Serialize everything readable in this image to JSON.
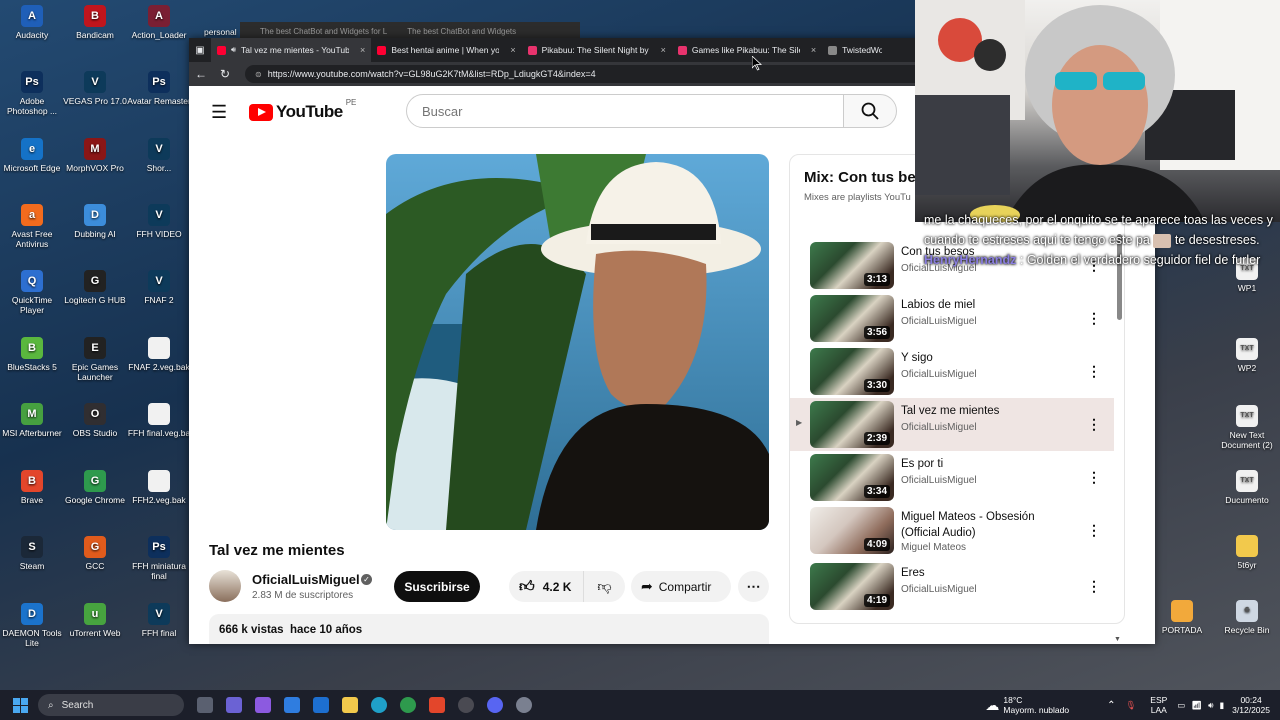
{
  "desktop": {
    "icons": [
      {
        "label": "Audacity",
        "color": "#1f5fb8",
        "g": "A"
      },
      {
        "label": "Bandicam",
        "color": "#c0151d",
        "g": "B"
      },
      {
        "label": "Action_Loader",
        "color": "#7a1f33",
        "g": "A"
      },
      {
        "label": "Adobe Photoshop ...",
        "color": "#0d2f5c",
        "g": "Ps"
      },
      {
        "label": "VEGAS Pro 17.0",
        "color": "#0d3a5a",
        "g": "V"
      },
      {
        "label": "Avatar Remaster",
        "color": "#0d2f5c",
        "g": "Ps"
      },
      {
        "label": "Microsoft Edge",
        "color": "#1572c7",
        "g": "e"
      },
      {
        "label": "MorphVOX Pro",
        "color": "#8a1616",
        "g": "M"
      },
      {
        "label": "Shor...",
        "color": "#0d3a5a",
        "g": "V"
      },
      {
        "label": "Avast Free Antivirus",
        "color": "#f26b1d",
        "g": "a"
      },
      {
        "label": "Dubbing AI",
        "color": "#3c8ddb",
        "g": "D"
      },
      {
        "label": "FFH VIDEO",
        "color": "#0d3a5a",
        "g": "V"
      },
      {
        "label": "QuickTime Player",
        "color": "#2d6fd0",
        "g": "Q"
      },
      {
        "label": "Logitech G HUB",
        "color": "#222222",
        "g": "G"
      },
      {
        "label": "FNAF 2",
        "color": "#0d3a5a",
        "g": "V"
      },
      {
        "label": "BlueStacks 5",
        "color": "#5ab73e",
        "g": "B"
      },
      {
        "label": "Epic Games Launcher",
        "color": "#222222",
        "g": "E"
      },
      {
        "label": "FNAF 2.veg.bak",
        "color": "#f1f1f1",
        "g": ""
      },
      {
        "label": "MSI Afterburner",
        "color": "#46a040",
        "g": "M"
      },
      {
        "label": "OBS Studio",
        "color": "#302e31",
        "g": "O"
      },
      {
        "label": "FFH final.veg.ba",
        "color": "#f1f1f1",
        "g": ""
      },
      {
        "label": "Brave",
        "color": "#e3462b",
        "g": "B"
      },
      {
        "label": "Google Chrome",
        "color": "#2e9a4d",
        "g": "G"
      },
      {
        "label": "FFH2.veg.bak",
        "color": "#f1f1f1",
        "g": ""
      },
      {
        "label": "Steam",
        "color": "#1b2838",
        "g": "S"
      },
      {
        "label": "GCC",
        "color": "#e05b1c",
        "g": "G"
      },
      {
        "label": "FFH miniatura final",
        "color": "#0d2f5c",
        "g": "Ps"
      },
      {
        "label": "DAEMON Tools Lite",
        "color": "#1b73cc",
        "g": "D"
      },
      {
        "label": "uTorrent Web",
        "color": "#47a43f",
        "g": "u"
      },
      {
        "label": "FFH final",
        "color": "#0d3a5a",
        "g": "V"
      }
    ],
    "right_icons": [
      {
        "label": "WP1",
        "color": "#f1f1f1",
        "g": "TXT"
      },
      {
        "label": "WP2",
        "color": "#f1f1f1",
        "g": "TXT"
      },
      {
        "label": "New Text Document (2)",
        "color": "#f1f1f1",
        "g": "TXT"
      },
      {
        "label": "Ducumento",
        "color": "#f1f1f1",
        "g": "TXT"
      },
      {
        "label": "5t6yr",
        "color": "#f2c94c",
        "g": ""
      },
      {
        "label": "PORTADA",
        "color": "#f2a93b",
        "g": ""
      },
      {
        "label": "Recycle Bin",
        "color": "#cfd8e3",
        "g": "♻"
      }
    ],
    "partial_label": "personal",
    "back_tab_1": "The best ChatBot and Widgets for L",
    "back_tab_2": "The best ChatBot and Widgets"
  },
  "browser": {
    "tabs": [
      {
        "label": "Tal vez me mientes - YouTub",
        "active": true
      },
      {
        "label": "Best hentai anime | When you m",
        "active": false
      },
      {
        "label": "Pikabuu: The Silent Night by Joyk",
        "active": false
      },
      {
        "label": "Games like Pikabuu: The Silent Ni",
        "active": false
      },
      {
        "label": "TwistedWo",
        "active": false
      }
    ],
    "url": "https://www.youtube.com/watch?v=GL98uG2K7tM&list=RDp_LdiugkGT4&index=4"
  },
  "youtube": {
    "country_code": "PE",
    "logo_text": "YouTube",
    "search_placeholder": "Buscar",
    "video_title": "Tal vez me mientes",
    "channel_name": "OficialLuisMiguel",
    "subscribers": "2.83 M de suscriptores",
    "subscribe_label": "Suscribirse",
    "likes": "4.2 K",
    "share_label": "Compartir",
    "views_meta": "666 k vistas  hace 10 años"
  },
  "playlist": {
    "title": "Mix: Con tus be",
    "subtitle": "Mixes are playlists YouTu",
    "items": [
      {
        "title": "Con tus besos",
        "channel": "OficialLuisMiguel",
        "duration": "3:13",
        "current": false,
        "alt": false
      },
      {
        "title": "Labios de miel",
        "channel": "OficialLuisMiguel",
        "duration": "3:56",
        "current": false,
        "alt": false
      },
      {
        "title": "Y sigo",
        "channel": "OficialLuisMiguel",
        "duration": "3:30",
        "current": false,
        "alt": false
      },
      {
        "title": "Tal vez me mientes",
        "channel": "OficialLuisMiguel",
        "duration": "2:39",
        "current": true,
        "alt": false
      },
      {
        "title": "Es por ti",
        "channel": "OficialLuisMiguel",
        "duration": "3:34",
        "current": false,
        "alt": false
      },
      {
        "title": "Miguel Mateos - Obsesión (Official Audio)",
        "channel": "Miguel Mateos",
        "duration": "4:09",
        "current": false,
        "alt": true
      },
      {
        "title": "Eres",
        "channel": "OficialLuisMiguel",
        "duration": "4:19",
        "current": false,
        "alt": false
      }
    ]
  },
  "chat": {
    "line1": "me la chaqueces, por el onquito se te aparece toas las veces y cuando te estreses aqui te tengo este pa",
    "line1b": "te desestreses.",
    "user": "HenryHernandz",
    "line2": ": Golden el verdadero seguidor fiel de furler"
  },
  "taskbar": {
    "search_label": "Search",
    "weather_temp": "18°C",
    "weather_desc": "Mayorm. nublado",
    "lang1": "ESP",
    "lang2": "LAA",
    "time": "00:24",
    "date": "3/12/2025"
  }
}
